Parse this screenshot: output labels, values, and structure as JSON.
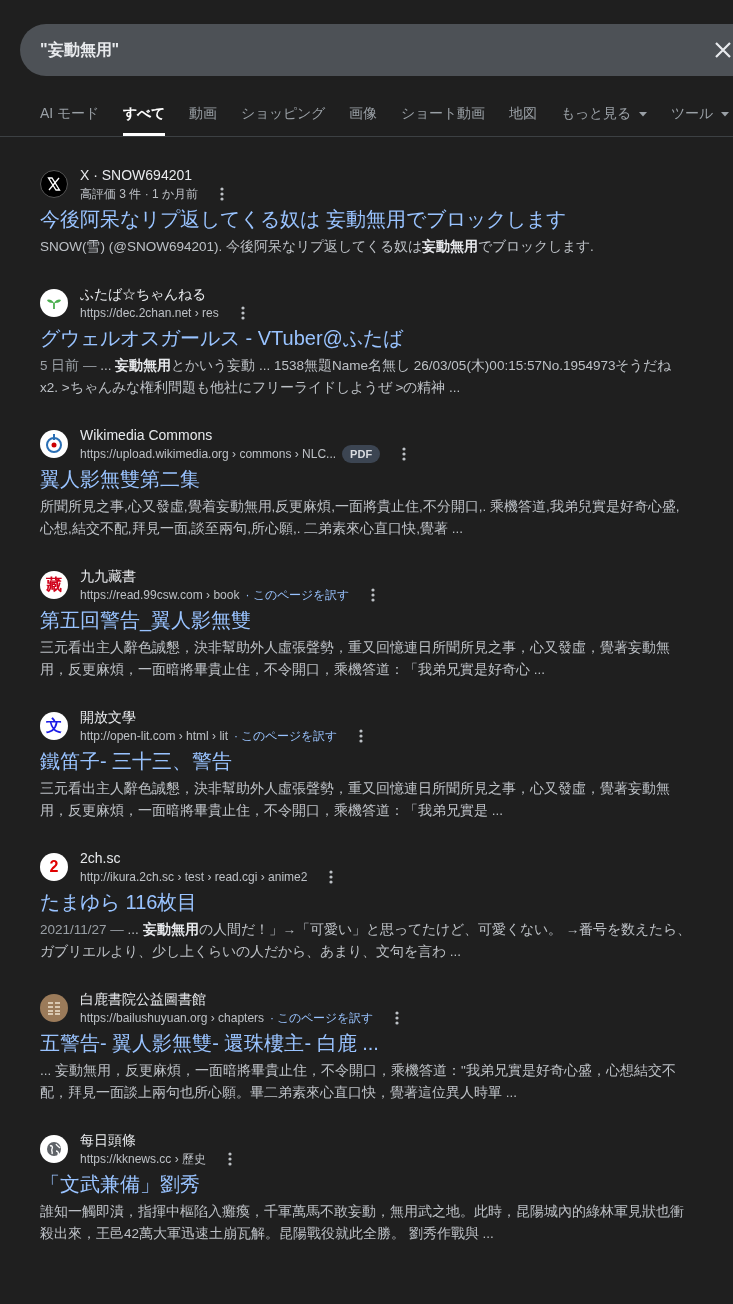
{
  "search": {
    "value": "\"妄動無用\""
  },
  "tabs": [
    {
      "label": "AI モード",
      "selected": false,
      "dropdown": false
    },
    {
      "label": "すべて",
      "selected": true,
      "dropdown": false
    },
    {
      "label": "動画",
      "selected": false,
      "dropdown": false
    },
    {
      "label": "ショッピング",
      "selected": false,
      "dropdown": false
    },
    {
      "label": "画像",
      "selected": false,
      "dropdown": false
    },
    {
      "label": "ショート動画",
      "selected": false,
      "dropdown": false
    },
    {
      "label": "地図",
      "selected": false,
      "dropdown": false
    },
    {
      "label": "もっと見る",
      "selected": false,
      "dropdown": true
    },
    {
      "label": "ツール",
      "selected": false,
      "dropdown": true
    }
  ],
  "results": [
    {
      "favicon": {
        "kind": "x"
      },
      "site": "X · SNOW694201",
      "meta": "高評価 3 件 · 1 か月前",
      "title": "今後阿呆なリプ返してくる奴は 妄動無用でブロックします",
      "snippet": "SNOW(雪) (@SNOW694201). 今後阿呆なリプ返してくる奴は**妄動無用**でブロックします."
    },
    {
      "favicon": {
        "kind": "sprout"
      },
      "site": "ふたば☆ちゃんねる",
      "url": "https://dec.2chan.net › res",
      "title": "グウェルオスガールス - VTuber@ふたば",
      "date": "5 日前 — ",
      "snippet": "... **妄動無用**とかいう妄動 ... 1538無題Name名無し 26/03/05(木)00:15:57No.1954973そうだね x2. >ちゃんみな権利問題も他社にフリーライドしようぜ >の精神 ..."
    },
    {
      "favicon": {
        "kind": "wiki"
      },
      "site": "Wikimedia Commons",
      "url": "https://upload.wikimedia.org › commons › NLC...",
      "badge": "PDF",
      "title": "翼人影無雙第二集",
      "snippet": "所聞所見之事,心又發虛,覺着妄動無用,反更麻煩,一面將貴止住,不分開口,. 乘機答道,我弟兒實是好奇心盛,心想,結交不配,拜見一面,談至兩句,所心願,. 二弟素來心直口快,覺著 ..."
    },
    {
      "favicon": {
        "kind": "char",
        "text": "藏",
        "color": "#d0021b"
      },
      "site": "九九藏書",
      "url": "https://read.99csw.com › book",
      "translate": "· このページを訳す",
      "title": "第五回警告_翼人影無雙",
      "snippet": "三元看出主人辭色誠懇，決非幫助外人虛張聲勢，重又回憶連日所聞所見之事，心又發虛，覺著妄動無用，反更麻煩，一面暗將畢貴止住，不令開口，乘機答道：「我弟兄實是好奇心 ..."
    },
    {
      "favicon": {
        "kind": "char",
        "text": "文",
        "color": "#1a1ae6"
      },
      "site": "開放文學",
      "url": "http://open-lit.com › html › lit",
      "translate": "· このページを訳す",
      "title": "鐵笛子- 三十三、警告",
      "snippet": "三元看出主人辭色誠懇，決非幫助外人虛張聲勢，重又回憶連日所聞所見之事，心又發虛，覺著妄動無用，反更麻煩，一面暗將畢貴止住，不令開口，乘機答道：「我弟兄實是 ..."
    },
    {
      "favicon": {
        "kind": "char",
        "text": "2",
        "color": "#e00000"
      },
      "site": "2ch.sc",
      "url": "http://ikura.2ch.sc › test › read.cgi › anime2",
      "title": "たまゆら 116枚目",
      "date": "2021/11/27 — ",
      "snippet": "... **妄動無用**の人間だ！」→「可愛い」と思ってたけど、可愛くない。 →番号を数えたら、ガブリエルより、少し上くらいの人だから、あまり、文句を言わ ..."
    },
    {
      "favicon": {
        "kind": "seal"
      },
      "site": "白鹿書院公益圖書館",
      "url": "https://bailushuyuan.org › chapters",
      "translate": "· このページを訳す",
      "title": "五警告- 翼人影無雙- 還珠樓主- 白鹿 ...",
      "snippet": "... 妄動無用，反更麻煩，一面暗將畢貴止住，不令開口，乘機答道：\"我弟兄實是好奇心盛，心想結交不配，拜見一面談上兩句也所心願。畢二弟素來心直口快，覺著這位異人時單 ..."
    },
    {
      "favicon": {
        "kind": "globe"
      },
      "site": "每日頭條",
      "url": "https://kknews.cc › 歷史",
      "title": "「文武兼備」劉秀",
      "snippet": "誰知一觸即潰，指揮中樞陷入癱瘓，千軍萬馬不敢妄動，無用武之地。此時，昆陽城內的綠林軍見狀也衝殺出來，王邑42萬大軍迅速土崩瓦解。昆陽戰役就此全勝。 劉秀作戰與 ..."
    }
  ]
}
